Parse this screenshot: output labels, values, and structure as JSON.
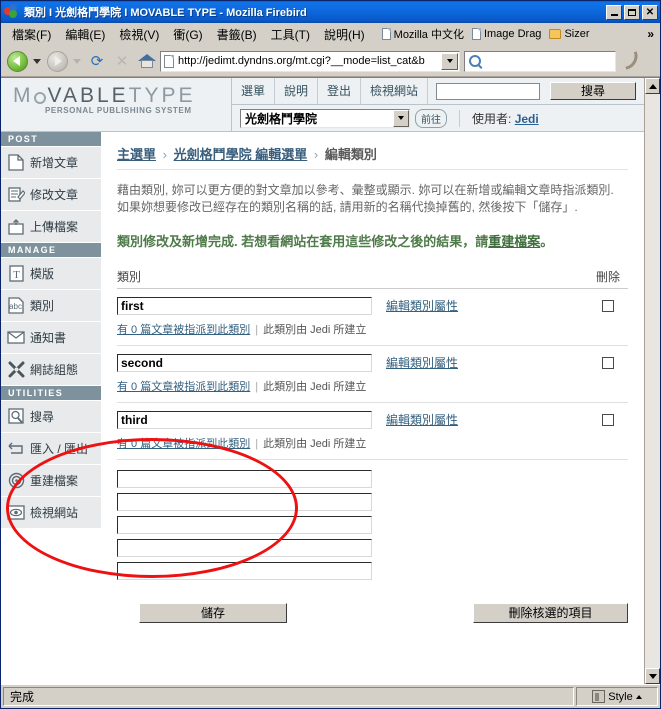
{
  "window": {
    "title": "類別 I 光劍格鬥學院 I MOVABLE TYPE - Mozilla Firebird",
    "minimize": "_",
    "maximize": "□",
    "close": "✕"
  },
  "menubar": {
    "items": [
      "檔案(F)",
      "編輯(E)",
      "檢視(V)",
      "衝(G)",
      "書籤(B)",
      "工具(T)",
      "說明(H)"
    ],
    "bookmarks": [
      {
        "label": "Mozilla 中文化",
        "icon": "doc-icon"
      },
      {
        "label": "Image Drag",
        "icon": "doc-icon"
      },
      {
        "label": "Sizer",
        "icon": "folder-icon"
      }
    ],
    "overflow": "»"
  },
  "navbar": {
    "url": "http://jedimt.dyndns.org/mt.cgi?__mode=list_cat&b",
    "search_value": "",
    "search_placeholder": ""
  },
  "mt_header": {
    "logo_line1_left": "M",
    "logo_line1_mid": "VABLE",
    "logo_line1_right": "TYPE",
    "logo_line2": "PERSONAL PUBLISHING SYSTEM",
    "nav": [
      "選單",
      "說明",
      "登出",
      "檢視網站"
    ],
    "search_value": "",
    "search_button": "搜尋",
    "blog_selected": "光劍格鬥學院",
    "go_button": "前往",
    "user_label": "使用者:",
    "user_name": "Jedi"
  },
  "sidebar": {
    "sections": [
      {
        "heading": "POST",
        "items": [
          {
            "label": "新增文章",
            "icon": "new-document-icon"
          },
          {
            "label": "修改文章",
            "icon": "edit-document-icon"
          },
          {
            "label": "上傳檔案",
            "icon": "upload-folder-icon"
          }
        ]
      },
      {
        "heading": "MANAGE",
        "items": [
          {
            "label": "模版",
            "icon": "template-icon"
          },
          {
            "label": "類別",
            "icon": "abc-category-icon"
          },
          {
            "label": "通知書",
            "icon": "envelope-icon"
          },
          {
            "label": "網誌組態",
            "icon": "tools-icon"
          }
        ]
      },
      {
        "heading": "UTILITIES",
        "items": [
          {
            "label": "搜尋",
            "icon": "magnifier-icon"
          },
          {
            "label": "匯入 / 匯出",
            "icon": "import-export-icon"
          },
          {
            "label": "重建檔案",
            "icon": "rebuild-target-icon"
          },
          {
            "label": "檢視網站",
            "icon": "eye-view-icon"
          }
        ]
      }
    ]
  },
  "main": {
    "breadcrumb": {
      "home": "主選單",
      "sep": "›",
      "blog_menu": "光劍格鬥學院 編輯選單",
      "current": "編輯類別"
    },
    "intro": "藉由類別, 妳可以更方便的對文章加以參考、彙整或顯示. 妳可以在新增或編輯文章時指派類別. 如果妳想要修改已經存在的類別名稱的話, 請用新的名稱代換掉舊的, 然後按下「儲存」.",
    "success_text": "類別修改及新增完成. 若想看網站在套用這些修改之後的結果，請",
    "success_link": "重建檔案",
    "success_tail": "。",
    "columns": {
      "name": "類別",
      "delete": "刪除"
    },
    "categories": [
      {
        "name": "first",
        "edit_link": "編輯類別屬性",
        "count_link": "有 0 篇文章被指派到此類別",
        "author_text": "此類別由 Jedi 所建立",
        "checked": false
      },
      {
        "name": "second",
        "edit_link": "編輯類別屬性",
        "count_link": "有 0 篇文章被指派到此類別",
        "author_text": "此類別由 Jedi 所建立",
        "checked": false
      },
      {
        "name": "third",
        "edit_link": "編輯類別屬性",
        "count_link": "有 0 篇文章被指派到此類別",
        "author_text": "此類別由 Jedi 所建立",
        "checked": false
      }
    ],
    "new_category_inputs": [
      "",
      "",
      "",
      "",
      ""
    ],
    "save_button": "儲存",
    "delete_button": "刪除核選的項目"
  },
  "statusbar": {
    "text": "完成",
    "style_label": "Style"
  }
}
